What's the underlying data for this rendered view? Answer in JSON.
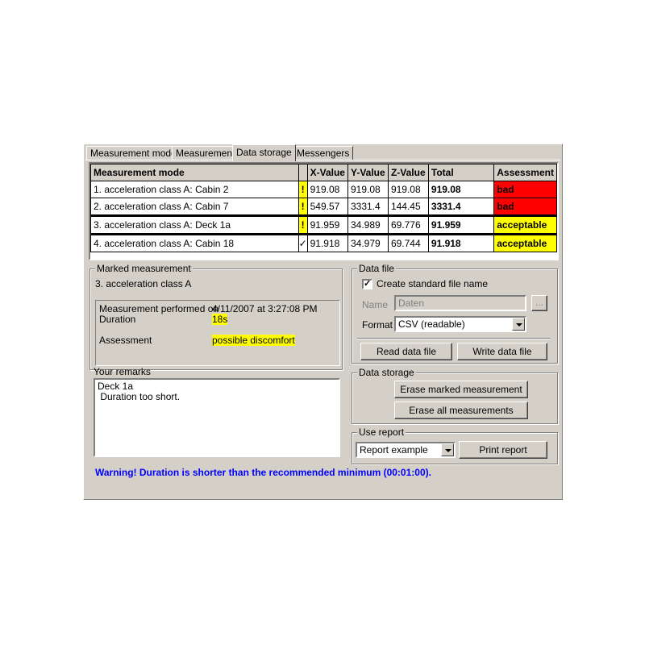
{
  "tabs": [
    "Measurement mode",
    "Measurement",
    "Data storage",
    "Messengers"
  ],
  "grid": {
    "headers": [
      "Measurement mode",
      "",
      "X-Value",
      "Y-Value",
      "Z-Value",
      "Total",
      "Assessment"
    ],
    "rows": [
      {
        "mode": "1. acceleration class A: Cabin 2",
        "flag": "!",
        "x": "919.08",
        "y": "919.08",
        "z": "919.08",
        "total": "919.08",
        "assessment": "bad"
      },
      {
        "mode": "2. acceleration class A: Cabin 7",
        "flag": "!",
        "x": "549.57",
        "y": "3331.4",
        "z": "144.45",
        "total": "3331.4",
        "assessment": "bad"
      },
      {
        "mode": "3. acceleration class A: Deck 1a",
        "flag": "!",
        "x": "91.959",
        "y": "34.989",
        "z": "69.776",
        "total": "91.959",
        "assessment": "acceptable"
      },
      {
        "mode": "4. acceleration class A: Cabin 18",
        "flag": "✓",
        "x": "91.918",
        "y": "34.979",
        "z": "69.744",
        "total": "91.918",
        "assessment": "acceptable"
      }
    ]
  },
  "marked": {
    "title": "Marked measurement",
    "name": "3. acceleration class A",
    "performed_label": "Measurement performed on",
    "performed_value": "4/11/2007 at 3:27:08 PM",
    "duration_label": "Duration",
    "duration_value": "18s",
    "assessment_label": "Assessment",
    "assessment_value": "possible discomfort"
  },
  "remarks": {
    "title": "Your remarks",
    "text": "Deck 1a\n Duration too short."
  },
  "datafile": {
    "title": "Data file",
    "create_label": "Create standard file name",
    "name_label": "Name",
    "name_value": "Daten",
    "browse_label": "...",
    "format_label": "Format",
    "format_value": "CSV (readable)",
    "read_label": "Read data file",
    "write_label": "Write data file"
  },
  "datastorage": {
    "title": "Data storage",
    "erase_marked_label": "Erase marked measurement",
    "erase_all_label": "Erase all measurements"
  },
  "report": {
    "title": "Use report",
    "select_value": "Report example",
    "print_label": "Print report"
  },
  "warning": "Warning!  Duration is shorter than the recommended minimum (00:01:00)."
}
